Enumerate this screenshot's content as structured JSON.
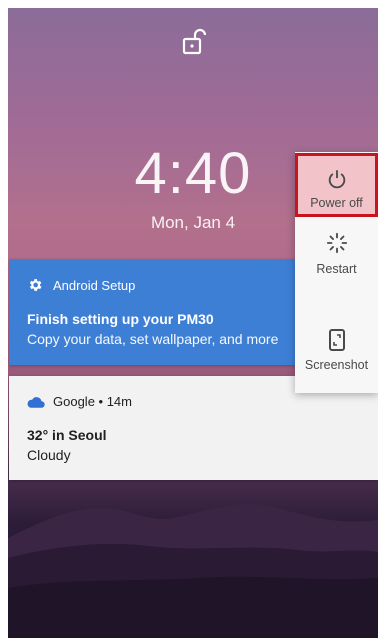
{
  "lockscreen": {
    "time": "4:40",
    "date": "Mon, Jan 4"
  },
  "notifications": {
    "setup": {
      "app": "Android Setup",
      "title": "Finish setting up your PM30",
      "text": "Copy your data, set wallpaper, and more",
      "color": "#3e7fd6"
    },
    "weather": {
      "app": "Google • 14m",
      "title": "32° in Seoul",
      "text": "Cloudy"
    }
  },
  "power_menu": {
    "items": [
      {
        "label": "Power off",
        "icon": "power-icon",
        "highlighted": true
      },
      {
        "label": "Restart",
        "icon": "restart-icon"
      },
      {
        "label": "Screenshot",
        "icon": "screenshot-icon"
      }
    ],
    "highlight_color": "#c8141e"
  },
  "icons": {
    "lock": "unlock-icon",
    "setup": "gear-icon",
    "weather": "cloud-icon"
  }
}
